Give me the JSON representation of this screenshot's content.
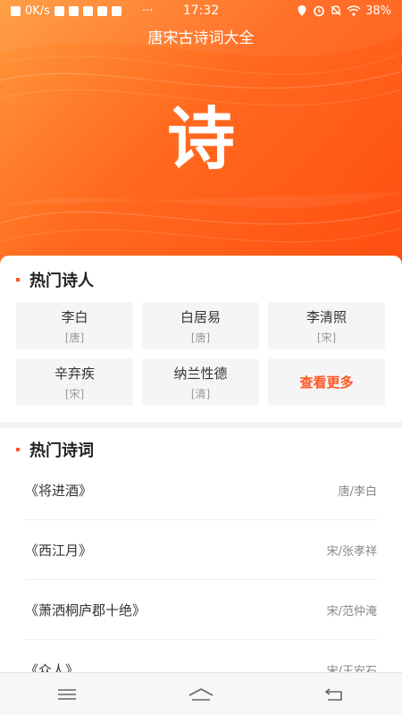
{
  "status_bar": {
    "speed": "0K/s",
    "more": "···",
    "time": "17:32",
    "battery": "38%"
  },
  "app": {
    "title": "唐宋古诗词大全",
    "logo_char": "诗"
  },
  "hot_poets": {
    "title": "热门诗人",
    "items": [
      {
        "name": "李白",
        "dynasty": "[唐]"
      },
      {
        "name": "白居易",
        "dynasty": "[唐]"
      },
      {
        "name": "李清照",
        "dynasty": "[宋]"
      },
      {
        "name": "辛弃疾",
        "dynasty": "[宋]"
      },
      {
        "name": "纳兰性德",
        "dynasty": "[清]"
      }
    ],
    "more_label": "查看更多"
  },
  "hot_poems": {
    "title": "热门诗词",
    "items": [
      {
        "title": "《将进酒》",
        "author": "唐/李白"
      },
      {
        "title": "《西江月》",
        "author": "宋/张孝祥"
      },
      {
        "title": "《萧洒桐庐郡十绝》",
        "author": "宋/范仲淹"
      },
      {
        "title": "《众人》",
        "author": "宋/王安石"
      }
    ]
  },
  "nav": {
    "icons": [
      "menu-icon",
      "home-icon",
      "back-icon"
    ]
  },
  "colors": {
    "accent": "#ff5722",
    "hero_start": "#ff9a3c",
    "hero_end": "#ff4e10"
  }
}
